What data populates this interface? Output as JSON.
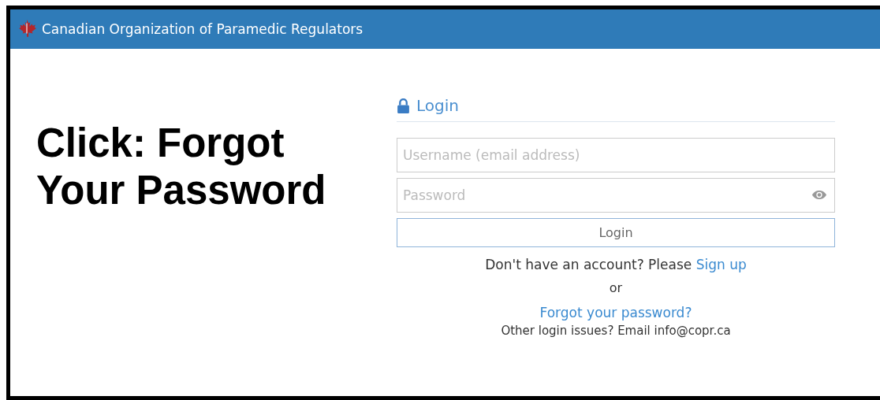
{
  "header": {
    "title": "Canadian Organization of Paramedic Regulators"
  },
  "annotation": {
    "lines": [
      "Click: Forgot",
      "Your Password"
    ]
  },
  "login": {
    "heading": "Login",
    "username": {
      "placeholder": "Username (email address)"
    },
    "password": {
      "placeholder": "Password"
    },
    "button": "Login",
    "signup": {
      "text": "Don't have an account? Please",
      "link": "Sign up"
    },
    "separator": "or",
    "forgot": "Forgot your password?",
    "other": "Other login issues? Email info@copr.ca"
  }
}
